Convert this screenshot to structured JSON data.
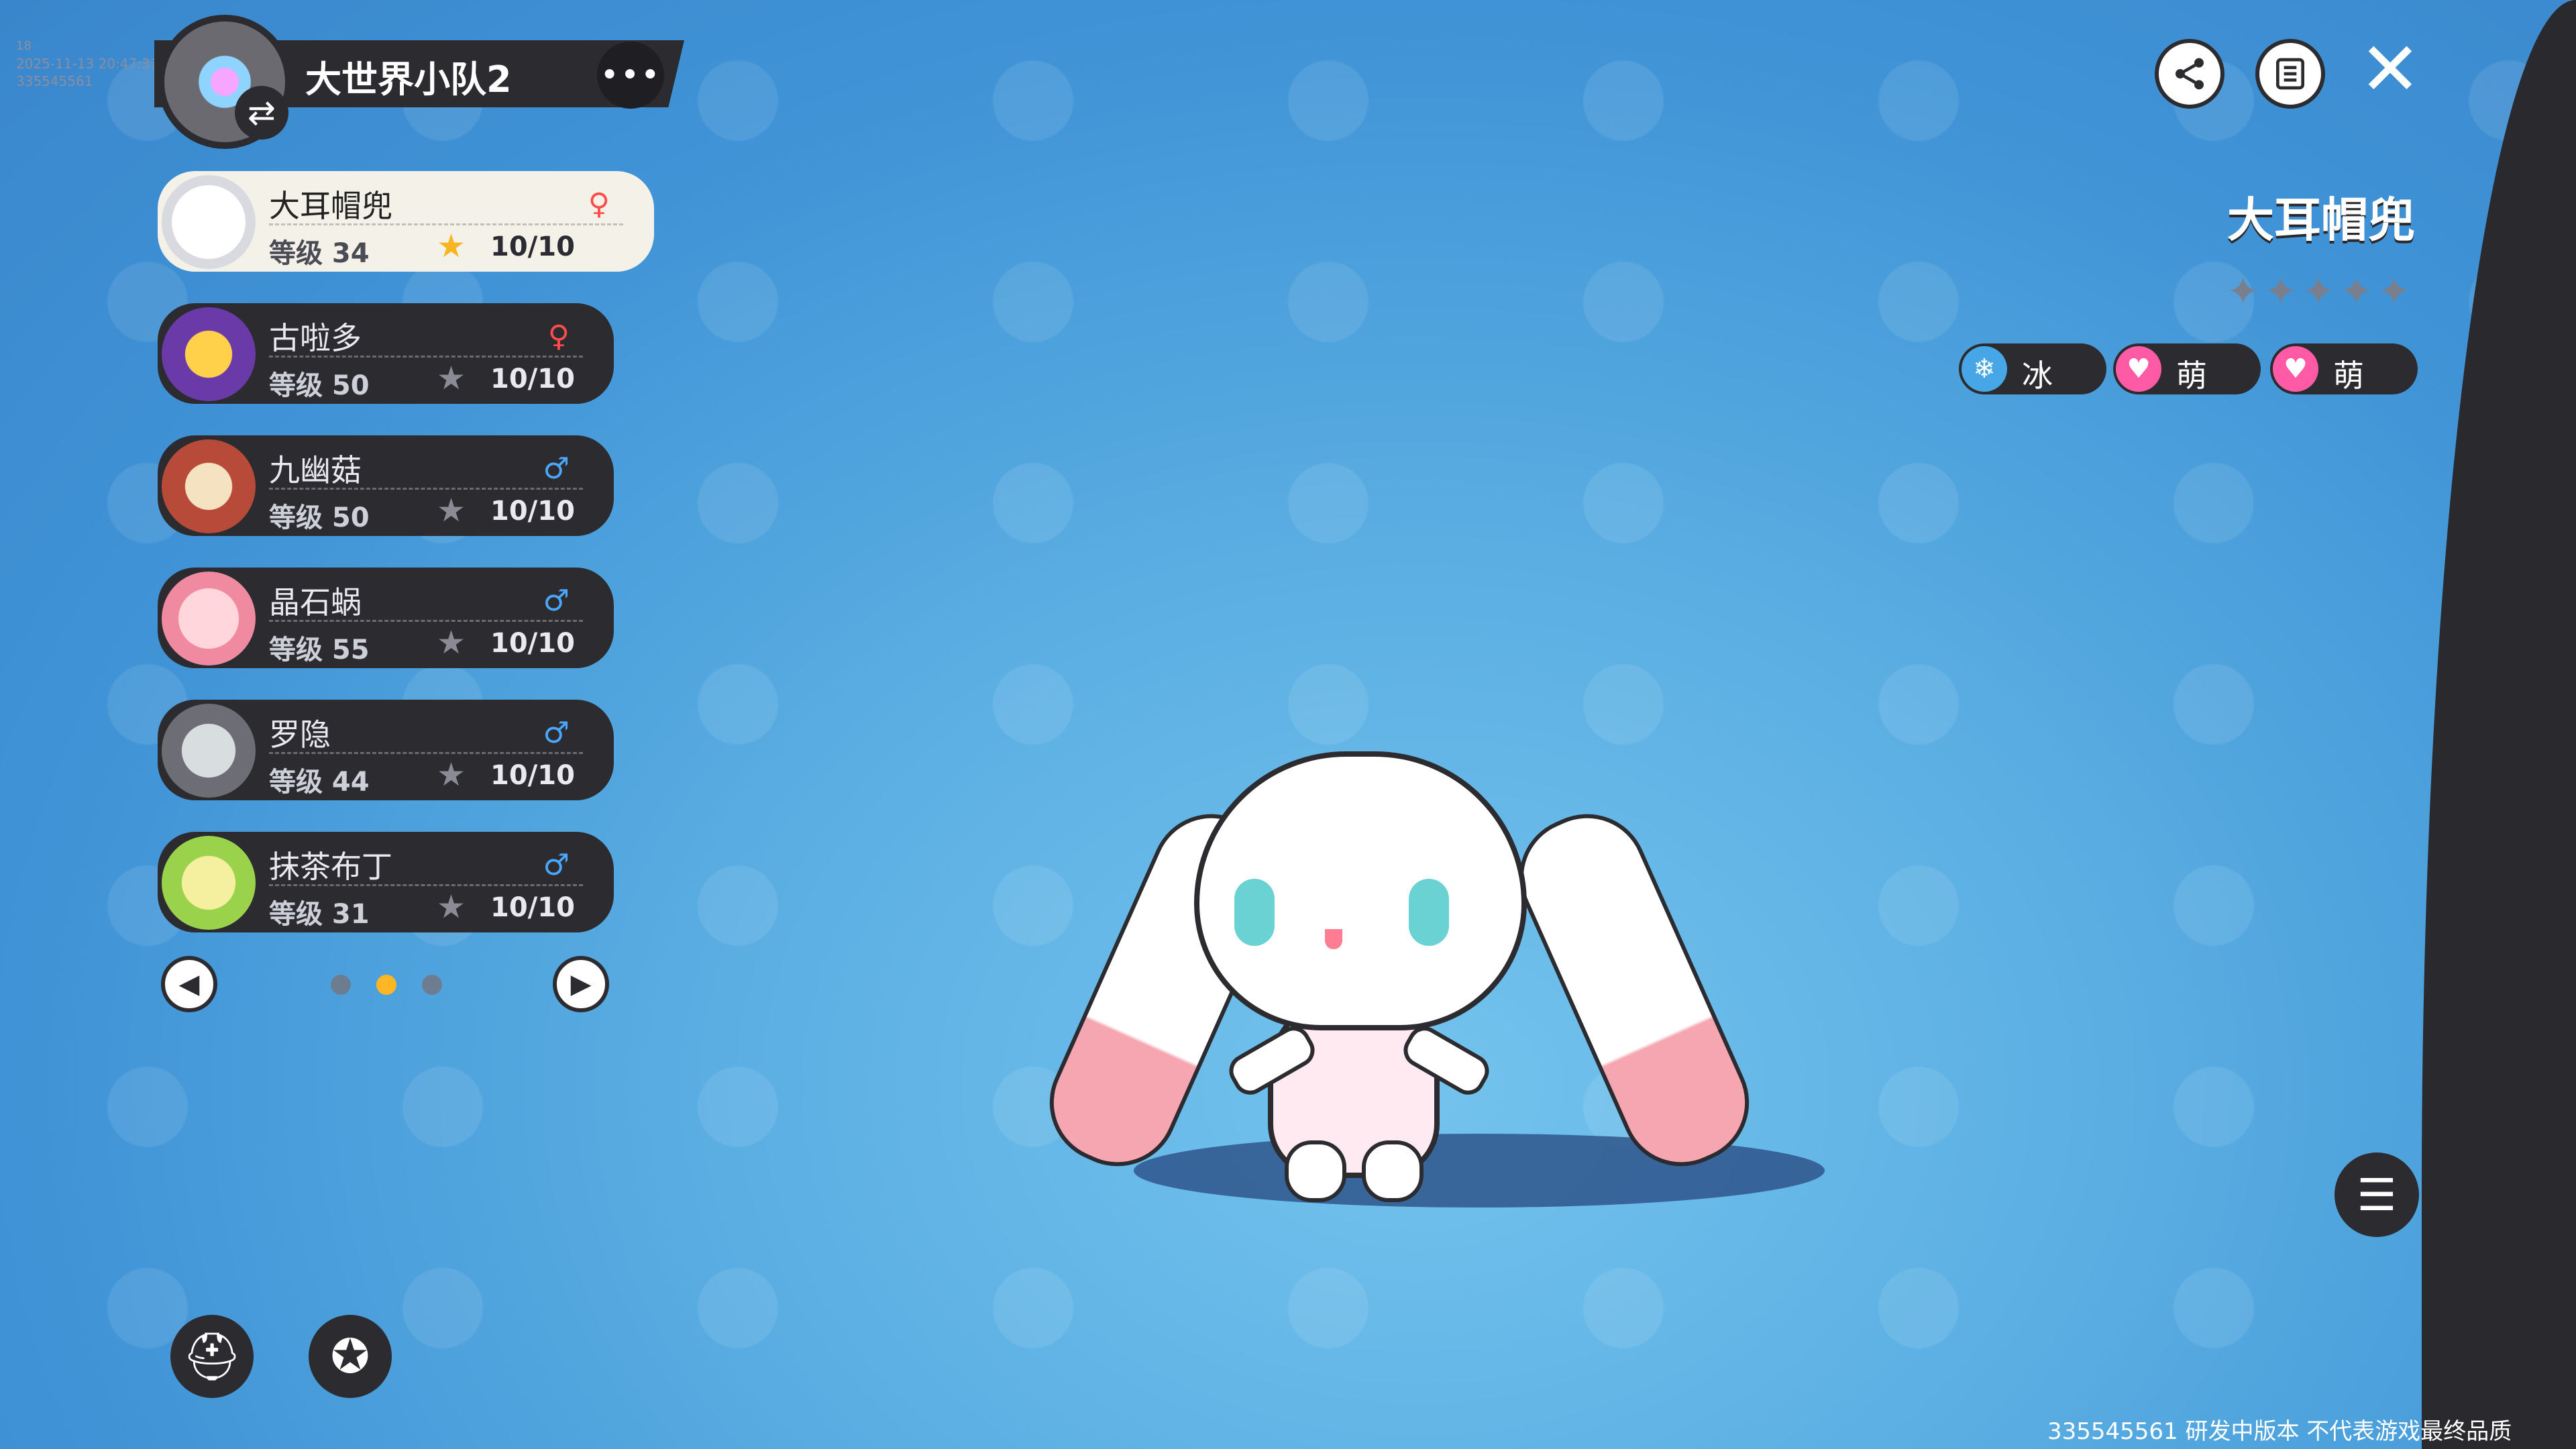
{
  "debug": {
    "line1": "18",
    "timestamp": "2025-11-13 20:47:37",
    "id": "335545561"
  },
  "team": {
    "name": "大世界小队2",
    "more_label": "•••"
  },
  "roster": [
    {
      "name": "大耳帽兜",
      "level": "等级 34",
      "count": "10/10",
      "gender": "♀",
      "selected": true
    },
    {
      "name": "古啦多",
      "level": "等级 50",
      "count": "10/10",
      "gender": "♀",
      "selected": false
    },
    {
      "name": "九幽菇",
      "level": "等级 50",
      "count": "10/10",
      "gender": "♂",
      "selected": false
    },
    {
      "name": "晶石蜗",
      "level": "等级 55",
      "count": "10/10",
      "gender": "♂",
      "selected": false
    },
    {
      "name": "罗隐",
      "level": "等级 44",
      "count": "10/10",
      "gender": "♂",
      "selected": false
    },
    {
      "name": "抹茶布丁",
      "level": "等级 31",
      "count": "10/10",
      "gender": "♂",
      "selected": false
    }
  ],
  "pager": {
    "prev": "◀",
    "next": "▶",
    "pages": 3,
    "active_page": 2
  },
  "detail": {
    "name": "大耳帽兜",
    "stars": "✦✦✦✦✦",
    "tags": [
      {
        "label": "冰",
        "icon": "❄",
        "type": "ice"
      },
      {
        "label": "萌",
        "icon": "♥",
        "type": "cute"
      },
      {
        "label": "萌",
        "icon": "♥",
        "type": "cute"
      }
    ]
  },
  "icons": {
    "share": "share-icon",
    "list": "list-icon",
    "close": "close-icon"
  },
  "footer": "335545561  研发中版本 不代表游戏最终品质",
  "colors": {
    "panel": "#2c2c30",
    "active_star": "#f6b623",
    "male": "#4aa7ff",
    "female": "#ff4d4d"
  }
}
